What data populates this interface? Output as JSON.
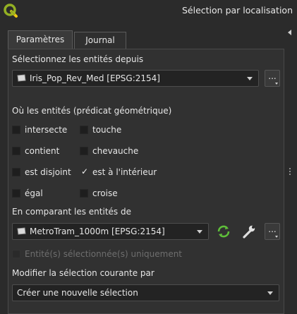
{
  "window": {
    "title": "Sélection par localisation"
  },
  "tabs": [
    {
      "label": "Paramètres",
      "active": true
    },
    {
      "label": "Journal",
      "active": false
    }
  ],
  "source": {
    "label": "Sélectionnez les entités depuis",
    "layer": "Iris_Pop_Rev_Med [EPSG:2154]",
    "more_button": "..."
  },
  "predicate": {
    "label": "Où les entités (prédicat géométrique)",
    "options": [
      {
        "label": "intersecte",
        "checked": false
      },
      {
        "label": "touche",
        "checked": false
      },
      {
        "label": "contient",
        "checked": false
      },
      {
        "label": "chevauche",
        "checked": false
      },
      {
        "label": "est disjoint",
        "checked": false
      },
      {
        "label": "est à l'intérieur",
        "checked": true
      },
      {
        "label": "égal",
        "checked": false
      },
      {
        "label": "croise",
        "checked": false
      }
    ]
  },
  "compare": {
    "label": "En comparant les entités de",
    "layer": "MetroTram_1000m [EPSG:2154]",
    "more_button": "...",
    "selected_only": {
      "label": "Entité(s) sélectionnée(s) uniquement",
      "checked": false,
      "enabled": false
    }
  },
  "modify": {
    "label": "Modifier la sélection courante par",
    "value": "Créer une nouvelle sélection"
  },
  "colors": {
    "accent_green": "#5fbf3a",
    "background": "#2b2b2b",
    "panel": "#313131"
  }
}
